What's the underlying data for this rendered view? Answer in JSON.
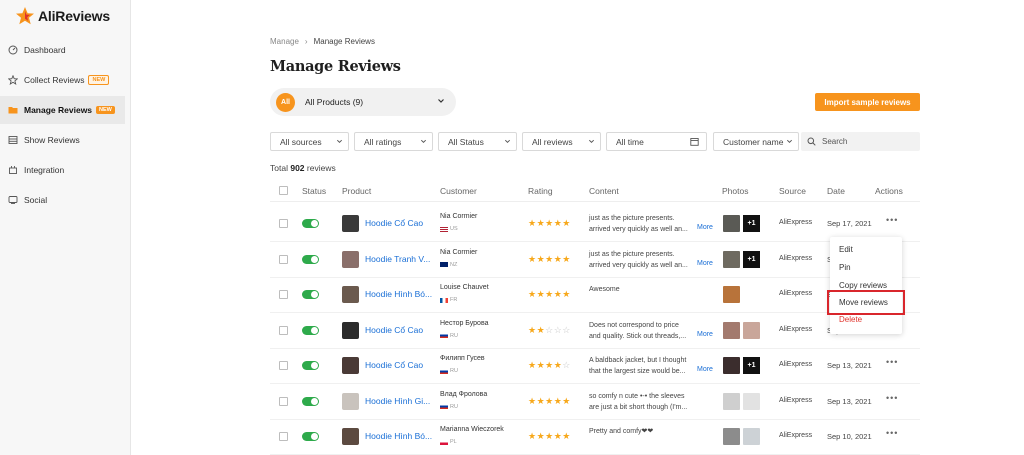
{
  "app": {
    "name": "AliReviews"
  },
  "sidebar": {
    "items": [
      {
        "label": "Dashboard",
        "icon": "dashboard-icon",
        "badge": ""
      },
      {
        "label": "Collect Reviews",
        "icon": "star-icon",
        "badge": "NEW"
      },
      {
        "label": "Manage Reviews",
        "icon": "folder-icon",
        "badge": "NEW"
      },
      {
        "label": "Show Reviews",
        "icon": "list-icon",
        "badge": ""
      },
      {
        "label": "Integration",
        "icon": "plug-icon",
        "badge": ""
      },
      {
        "label": "Social",
        "icon": "share-icon",
        "badge": ""
      }
    ]
  },
  "breadcrumb": {
    "parent": "Manage",
    "sep": "›",
    "current": "Manage Reviews"
  },
  "page": {
    "title": "Manage Reviews",
    "all_label": "All",
    "product_filter": "All Products (9)",
    "import_button": "Import sample reviews"
  },
  "filters": {
    "sources": "All sources",
    "ratings": "All ratings",
    "status": "All Status",
    "reviews": "All reviews",
    "time": "All time",
    "customer": "Customer name",
    "search_placeholder": "Search"
  },
  "total": {
    "prefix": "Total",
    "count": "902",
    "suffix": "reviews"
  },
  "table": {
    "headers": [
      "Status",
      "Product",
      "Customer",
      "Rating",
      "Content",
      "Photos",
      "Source",
      "Date",
      "Actions"
    ],
    "rows": [
      {
        "product": "Hoodie Cổ Cao",
        "customer": "Nia Cormier",
        "country": "US",
        "rating": 5,
        "content1": "just as the picture presents.",
        "content2": "arrived very quickly as well an...",
        "more": "More",
        "photos": 2,
        "plus": "+1",
        "source": "AliExpress",
        "date": "Sep 17, 2021"
      },
      {
        "product": "Hoodie Tranh V...",
        "customer": "Nia Cormier",
        "country": "NZ",
        "rating": 5,
        "content1": "just as the picture presents.",
        "content2": "arrived very quickly as well an...",
        "more": "More",
        "photos": 2,
        "plus": "+1",
        "source": "AliExpress",
        "date": "S"
      },
      {
        "product": "Hoodie Hình Bó...",
        "customer": "Louise Chauvet",
        "country": "FR",
        "rating": 5,
        "content1": "Awesome",
        "content2": "",
        "more": "",
        "photos": 1,
        "plus": "",
        "source": "AliExpress",
        "date": "S"
      },
      {
        "product": "Hoodie Cổ Cao",
        "customer": "Нестор Бурова",
        "country": "RU",
        "rating": 2,
        "content1": "Does not correspond to price",
        "content2": "and quality. Stick out threads,...",
        "more": "More",
        "photos": 2,
        "plus": "",
        "source": "AliExpress",
        "date": "Sep 13, 2021"
      },
      {
        "product": "Hoodie Cổ Cao",
        "customer": "Филипп Гусев",
        "country": "RU",
        "rating": 4,
        "content1": "A baldback jacket, but I thought",
        "content2": "that the largest size would be...",
        "more": "More",
        "photos": 2,
        "plus": "+1",
        "source": "AliExpress",
        "date": "Sep 13, 2021"
      },
      {
        "product": "Hoodie Hình Gi...",
        "customer": "Влад Фролова",
        "country": "RU",
        "rating": 5,
        "content1": "so comfy n cute •-• the sleeves",
        "content2": "are just a bit short though (I'm...",
        "more": "",
        "photos": 2,
        "plus": "",
        "source": "AliExpress",
        "date": "Sep 13, 2021"
      },
      {
        "product": "Hoodie Hình Bó...",
        "customer": "Marianna Wieczorek",
        "country": "PL",
        "rating": 5,
        "content1": "Pretty and comfy❤❤",
        "content2": "",
        "more": "",
        "photos": 2,
        "plus": "",
        "source": "AliExpress",
        "date": "Sep 10, 2021"
      }
    ]
  },
  "context_menu": {
    "items": [
      "Edit",
      "Pin",
      "Copy reviews",
      "Move reviews",
      "Delete"
    ],
    "highlighted": "Move reviews"
  },
  "colors": {
    "accent": "#f7941d",
    "link": "#1a6fd6",
    "toggle": "#2eaa4b",
    "danger": "#e0322b",
    "highlight": "#d9262c"
  }
}
